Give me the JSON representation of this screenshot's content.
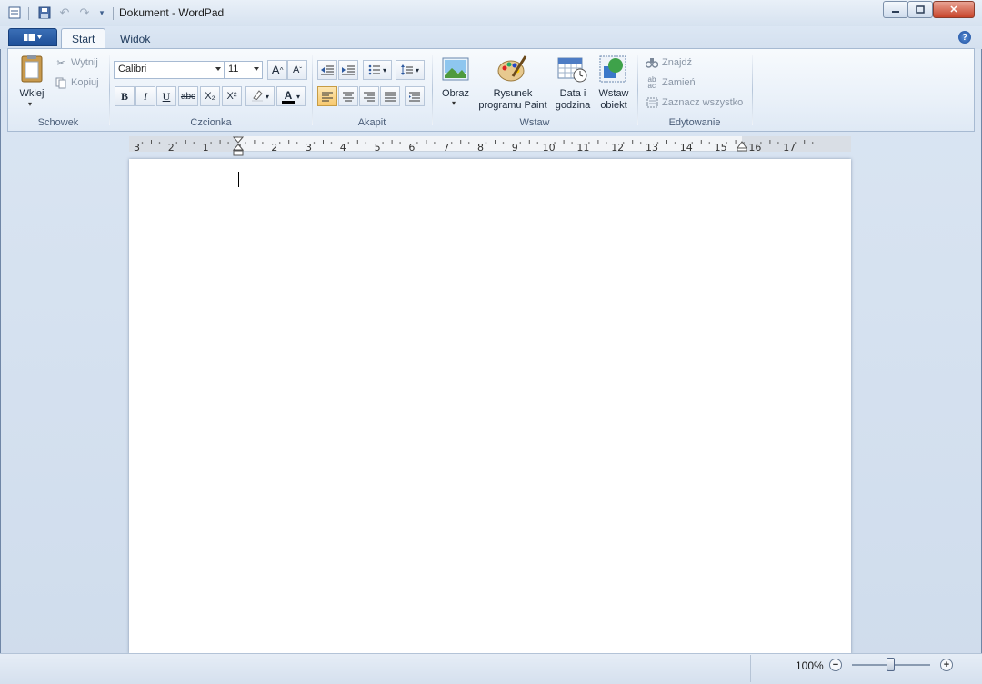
{
  "window": {
    "title": "Dokument - WordPad"
  },
  "quick_access": [
    "wordpad-app-icon",
    "save-icon",
    "undo-icon",
    "redo-icon",
    "customize-dropdown-icon"
  ],
  "tabs": [
    {
      "label": "Start",
      "active": true
    },
    {
      "label": "Widok",
      "active": false
    }
  ],
  "ribbon": {
    "clipboard": {
      "group_label": "Schowek",
      "paste_label": "Wklej",
      "cut_label": "Wytnij",
      "copy_label": "Kopiuj"
    },
    "font": {
      "group_label": "Czcionka",
      "family": "Calibri",
      "size": "11",
      "bold": "B",
      "italic": "I",
      "underline": "U",
      "strikethrough": "abc",
      "subscript": "X₂",
      "superscript": "X²",
      "grow": "A",
      "shrink": "A",
      "color_glyph": "A"
    },
    "paragraph": {
      "group_label": "Akapit"
    },
    "insert": {
      "group_label": "Wstaw",
      "picture": "Obraz",
      "paint_line1": "Rysunek",
      "paint_line2": "programu Paint",
      "datetime_line1": "Data i",
      "datetime_line2": "godzina",
      "object_line1": "Wstaw",
      "object_line2": "obiekt"
    },
    "editing": {
      "group_label": "Edytowanie",
      "find": "Znajdź",
      "replace": "Zamień",
      "select_all": "Zaznacz wszystko"
    }
  },
  "ruler": {
    "labels": [
      "3",
      "2",
      "1",
      "1",
      "2",
      "3",
      "4",
      "5",
      "6",
      "7",
      "8",
      "9",
      "10",
      "11",
      "12",
      "13",
      "14",
      "15",
      "16",
      "17"
    ]
  },
  "status": {
    "zoom": "100%",
    "zoom_level_percent": 100
  },
  "colors": {
    "accent": "#1f4f98",
    "highlight": "#f7c86d"
  }
}
